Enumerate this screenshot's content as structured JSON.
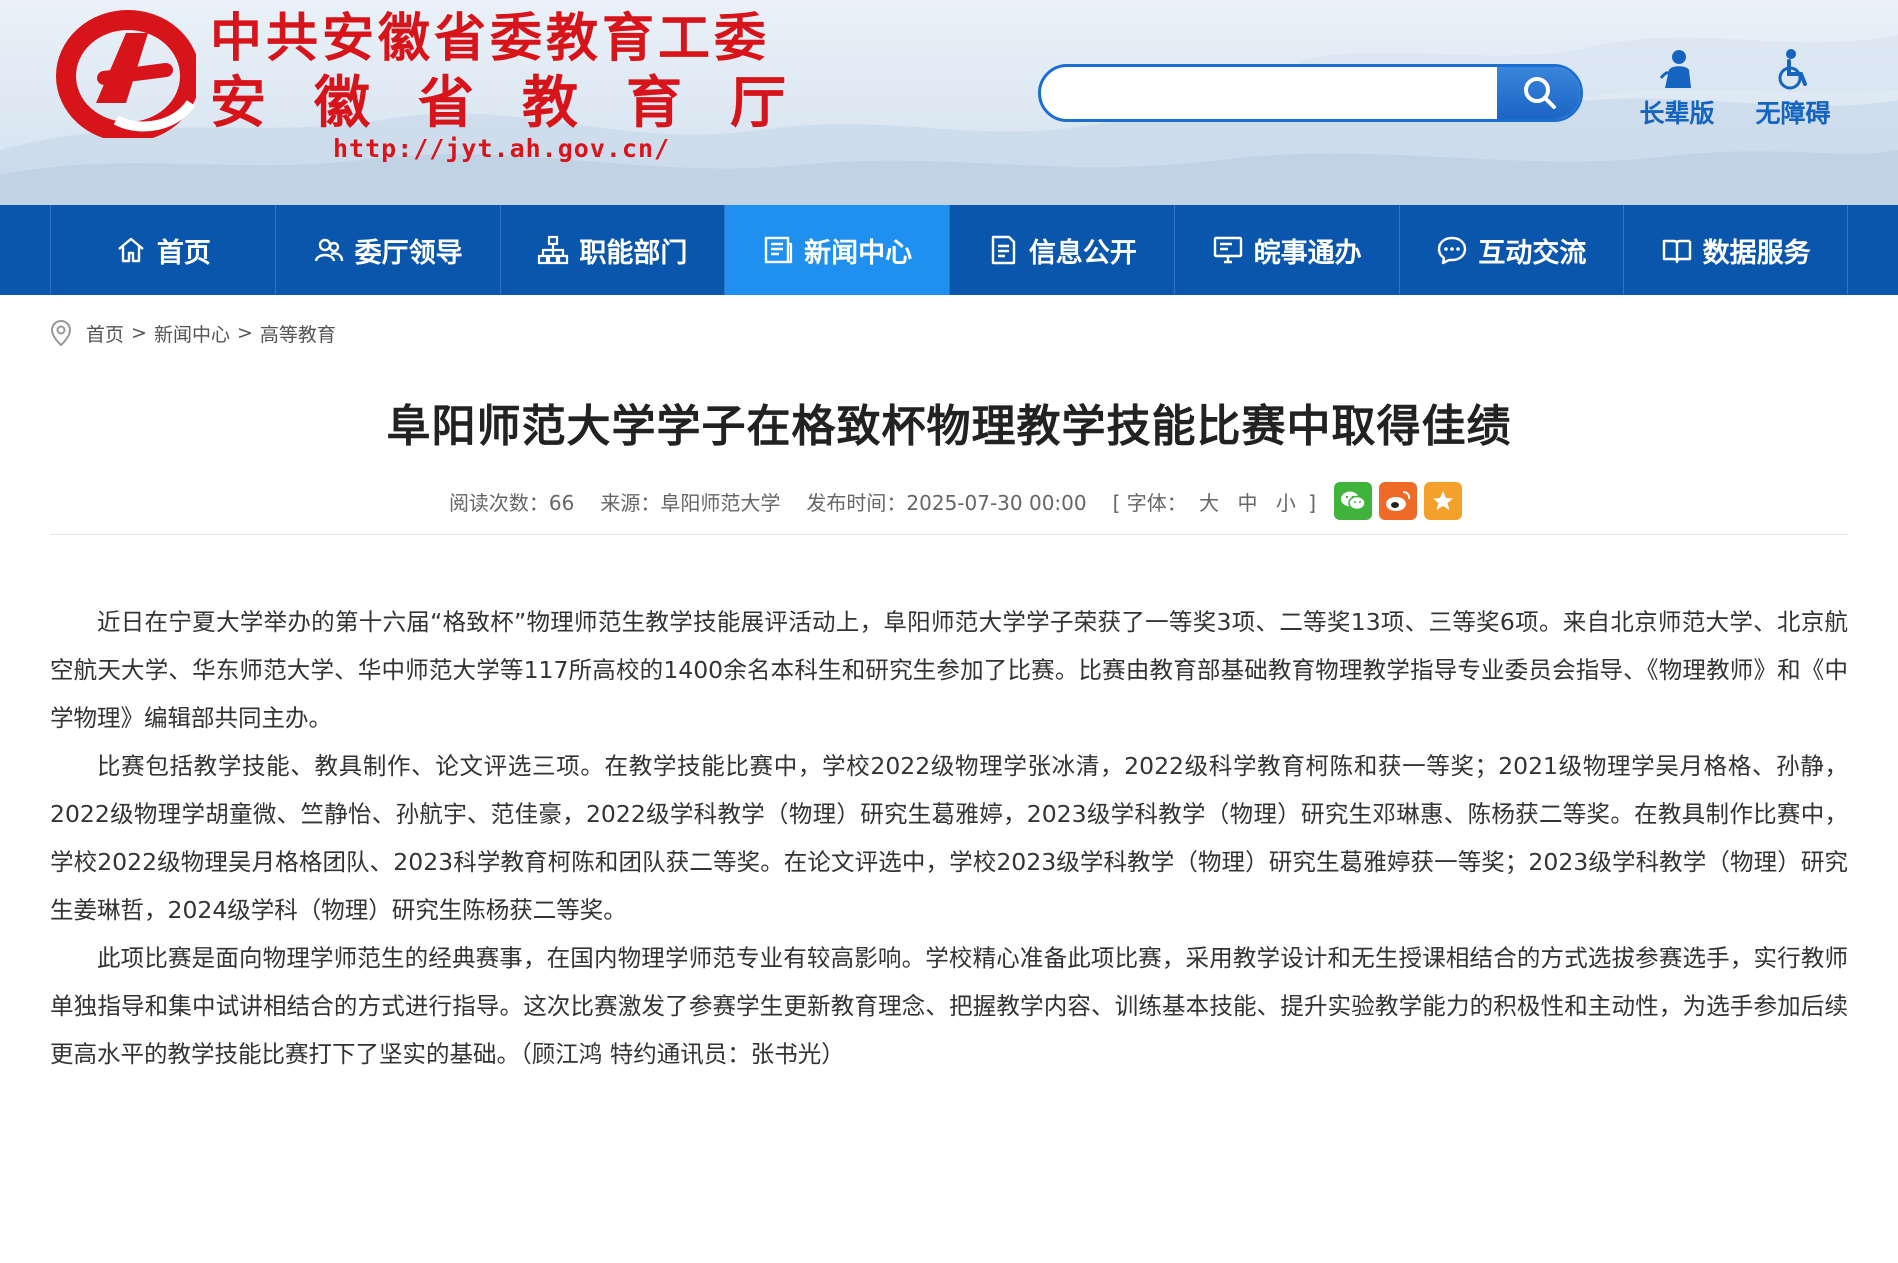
{
  "header": {
    "title_line1": "中共安徽省委教育工委",
    "title_line2": "安徽省教育厅",
    "url": "http://jyt.ah.gov.cn/",
    "logo_icon": "ah-education-logo-icon",
    "search": {
      "placeholder": "",
      "value": ""
    },
    "quick_links": [
      {
        "label": "长辈版",
        "icon": "elder-user-icon"
      },
      {
        "label": "无障碍",
        "icon": "wheelchair-icon"
      }
    ]
  },
  "nav": {
    "items": [
      {
        "label": "首页",
        "icon": "home-icon",
        "active": false
      },
      {
        "label": "委厅领导",
        "icon": "leaders-icon",
        "active": false
      },
      {
        "label": "职能部门",
        "icon": "org-chart-icon",
        "active": false
      },
      {
        "label": "新闻中心",
        "icon": "news-icon",
        "active": true
      },
      {
        "label": "信息公开",
        "icon": "document-icon",
        "active": false
      },
      {
        "label": "皖事通办",
        "icon": "monitor-icon",
        "active": false
      },
      {
        "label": "互动交流",
        "icon": "chat-icon",
        "active": false
      },
      {
        "label": "数据服务",
        "icon": "book-icon",
        "active": false
      }
    ]
  },
  "breadcrumb": {
    "items": [
      "首页",
      "新闻中心",
      "高等教育"
    ],
    "separator": ">"
  },
  "article": {
    "title": "阜阳师范大学学子在格致杯物理教学技能比赛中取得佳绩",
    "meta": {
      "reads": "阅读次数：66",
      "source": "来源：阜阳师范大学",
      "published": "发布时间：2025-07-30 00:00",
      "font_open": "[ 字体：",
      "font_large": "大",
      "font_medium": "中",
      "font_small": "小",
      "font_close": "]"
    },
    "share": [
      "wechat-icon",
      "weibo-icon",
      "star-icon"
    ],
    "paragraphs": [
      "近日在宁夏大学举办的第十六届“格致杯”物理师范生教学技能展评活动上，阜阳师范大学学子荣获了一等奖3项、二等奖13项、三等奖6项。来自北京师范大学、北京航空航天大学、华东师范大学、华中师范大学等117所高校的1400余名本科生和研究生参加了比赛。比赛由教育部基础教育物理教学指导专业委员会指导、《物理教师》和《中学物理》编辑部共同主办。",
      "比赛包括教学技能、教具制作、论文评选三项。在教学技能比赛中，学校2022级物理学张冰清，2022级科学教育柯陈和获一等奖；2021级物理学吴月格格、孙静，2022级物理学胡童微、竺静怡、孙航宇、范佳豪，2022级学科教学（物理）研究生葛雅婷，2023级学科教学（物理）研究生邓琳惠、陈杨获二等奖。在教具制作比赛中，学校2022级物理吴月格格团队、2023科学教育柯陈和团队获二等奖。在论文评选中，学校2023级学科教学（物理）研究生葛雅婷获一等奖；2023级学科教学（物理）研究生姜琳哲，2024级学科（物理）研究生陈杨获二等奖。",
      "此项比赛是面向物理学师范生的经典赛事，在国内物理学师范专业有较高影响。学校精心准备此项比赛，采用教学设计和无生授课相结合的方式选拔参赛选手，实行教师单独指导和集中试讲相结合的方式进行指导。这次比赛激发了参赛学生更新教育理念、把握教学内容、训练基本技能、提升实验教学能力的积极性和主动性，为选手参加后续更高水平的教学技能比赛打下了坚实的基础。（顾江鸿 特约通讯员：张书光）"
    ]
  },
  "colors": {
    "brand_red": "#d8141b",
    "nav_blue": "#0b56ad",
    "nav_active": "#1f8ff0",
    "link_blue": "#1565c0"
  }
}
